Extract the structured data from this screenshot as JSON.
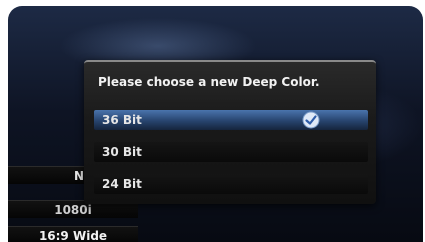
{
  "background": {
    "rows": [
      "N",
      "1080i",
      "16:9 Wide"
    ]
  },
  "dialog": {
    "title": "Please choose a new Deep Color.",
    "options": [
      {
        "label": "36 Bit",
        "selected": true
      },
      {
        "label": "30 Bit",
        "selected": false
      },
      {
        "label": "24 Bit",
        "selected": false
      }
    ]
  },
  "colors": {
    "highlight": "#3a5f95",
    "dialog_bg": "#1a1a1a",
    "text": "#f2f2f2"
  },
  "icons": {
    "selected_marker": "checkmark-shield-icon"
  }
}
